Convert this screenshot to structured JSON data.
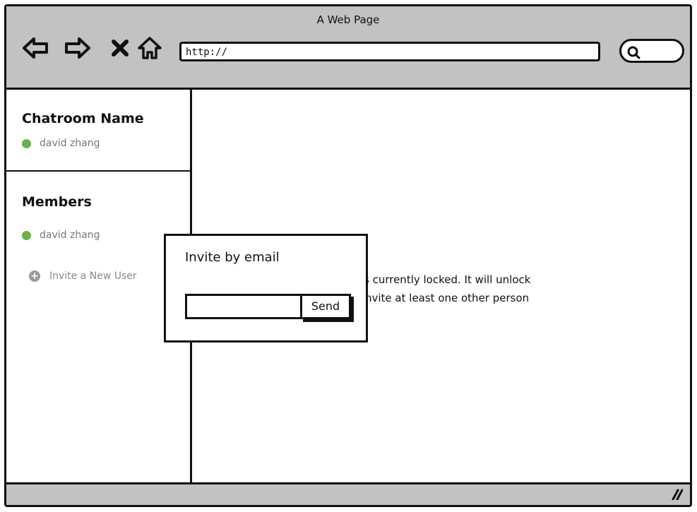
{
  "window": {
    "title": "A Web Page"
  },
  "toolbar": {
    "address": "http://",
    "icons": [
      "back-icon",
      "forward-icon",
      "close-icon",
      "home-icon",
      "search-icon"
    ]
  },
  "sidebar": {
    "chatroom": {
      "title": "Chatroom Name",
      "user": "david zhang"
    },
    "members": {
      "title": "Members",
      "items": [
        {
          "name": "david zhang",
          "status": "online"
        }
      ],
      "invite_label": "Invite a New User"
    }
  },
  "main": {
    "lock_message": {
      "line1": "s currently locked. It will unlock",
      "line2": "nvite at least one other person"
    }
  },
  "modal": {
    "title": "Invite by email",
    "email_value": "",
    "send_label": "Send"
  },
  "colors": {
    "chrome": "#c2c2c2",
    "online": "#6ab04c",
    "muted_text": "#777777"
  }
}
